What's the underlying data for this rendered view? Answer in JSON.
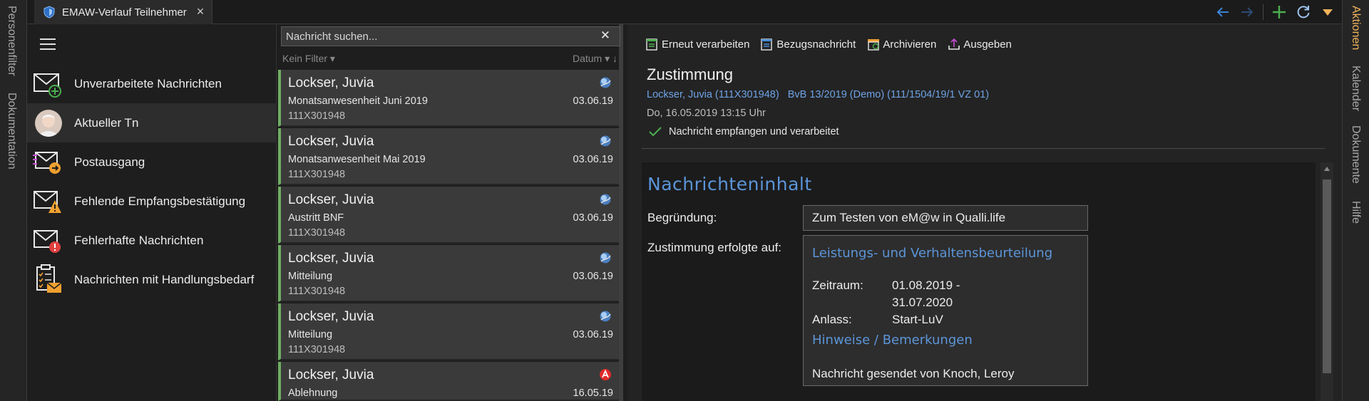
{
  "left_rail": {
    "items": [
      "Personenfilter",
      "Dokumentation"
    ]
  },
  "right_rail": {
    "items": [
      "Aktionen",
      "Kalender",
      "Dokumente",
      "Hilfe"
    ],
    "active": "Aktionen"
  },
  "tab": {
    "title": "EMAW-Verlauf Teilnehmer",
    "close": "×"
  },
  "colors": {
    "accent_blue": "#5b95d9",
    "link_blue": "#6ea3e6",
    "active_rail": "#f0b35a",
    "list_stripe": "#6fae63",
    "add_green": "#4caf50",
    "warn_orange": "#f0a030",
    "error_red": "#e04040"
  },
  "nav": {
    "items": [
      {
        "label": "Unverarbeitete Nachrichten",
        "icon": "envelope-plus-icon"
      },
      {
        "label": "Aktueller Tn",
        "icon": "avatar"
      },
      {
        "label": "Postausgang",
        "icon": "envelope-out-icon"
      },
      {
        "label": "Fehlende Empfangsbestätigung",
        "icon": "envelope-warning-icon"
      },
      {
        "label": "Fehlerhafte Nachrichten",
        "icon": "envelope-error-icon"
      },
      {
        "label": "Nachrichten mit Handlungsbedarf",
        "icon": "clipboard-envelope-icon"
      }
    ]
  },
  "list": {
    "search_placeholder": "Nachricht suchen...",
    "filter_label": "Kein Filter ▾",
    "sort_label": "Datum ▾  ↓",
    "messages": [
      {
        "name": "Lockser, Juvia",
        "subject": "Monatsanwesenheit Juni 2019",
        "id": "111X301948",
        "date": "03.06.19",
        "icon": "globe-icon"
      },
      {
        "name": "Lockser, Juvia",
        "subject": "Monatsanwesenheit Mai 2019",
        "id": "111X301948",
        "date": "03.06.19",
        "icon": "globe-icon"
      },
      {
        "name": "Lockser, Juvia",
        "subject": "Austritt BNF",
        "id": "111X301948",
        "date": "03.06.19",
        "icon": "globe-icon"
      },
      {
        "name": "Lockser, Juvia",
        "subject": "Mitteilung",
        "id": "111X301948",
        "date": "03.06.19",
        "icon": "globe-icon"
      },
      {
        "name": "Lockser, Juvia",
        "subject": "Mitteilung",
        "id": "111X301948",
        "date": "03.06.19",
        "icon": "globe-icon"
      },
      {
        "name": "Lockser, Juvia",
        "subject": "Ablehnung",
        "id": "",
        "date": "16.05.19",
        "icon": "agency-logo-icon"
      }
    ]
  },
  "detail": {
    "toolbar": {
      "reprocess": "Erneut verarbeiten",
      "reference": "Bezugsnachricht",
      "archive": "Archivieren",
      "export": "Ausgeben"
    },
    "title": "Zustimmung",
    "links": "Lockser, Juvia (111X301948)   BvB 13/2019 (Demo) (111/1504/19/1 VZ 01)",
    "date": "Do, 16.05.2019 13:15 Uhr",
    "status": "Nachricht empfangen und verarbeitet",
    "content": {
      "heading": "Nachrichteninhalt",
      "reason_label": "Begründung:",
      "reason_value": "Zum Testen von eM@w in Qualli.life",
      "consent_label": "Zustimmung erfolgte auf:",
      "section1": "Leistungs- und Verhaltensbeurteilung",
      "period_label": "Zeitraum:",
      "period_value_1": "01.08.2019 -",
      "period_value_2": "31.07.2020",
      "occasion_label": "Anlass:",
      "occasion_value": "Start-LuV",
      "section2": "Hinweise / Bemerkungen",
      "sent_by": "Nachricht gesendet von Knoch, Leroy"
    }
  }
}
